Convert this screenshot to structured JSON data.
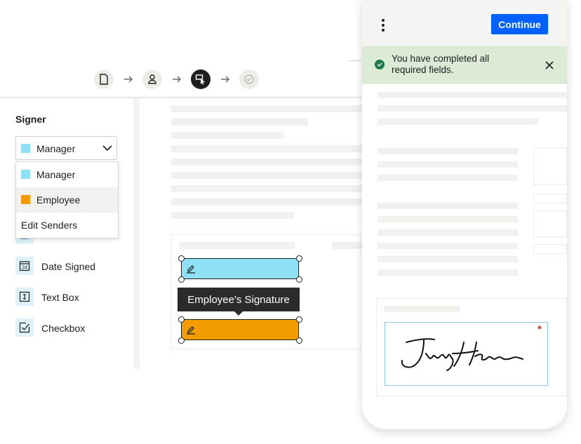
{
  "stepper": {
    "steps": [
      {
        "icon": "document-icon",
        "state": "done"
      },
      {
        "icon": "person-icon",
        "state": "done"
      },
      {
        "icon": "field-cursor-icon",
        "state": "active"
      },
      {
        "icon": "check-circle-icon",
        "state": "pending"
      }
    ]
  },
  "signer": {
    "title": "Signer",
    "selected": {
      "label": "Manager",
      "color": "#8ee0f4"
    },
    "options": [
      {
        "label": "Manager",
        "color": "#8ee0f4"
      },
      {
        "label": "Employee",
        "color": "#f29c00"
      },
      {
        "label": "Edit Senders"
      }
    ]
  },
  "tools": [
    {
      "label": "Date Signed",
      "icon": "calendar-24-icon"
    },
    {
      "label": "Text Box",
      "icon": "text-box-icon"
    },
    {
      "label": "Checkbox",
      "icon": "checkbox-icon"
    }
  ],
  "fields": {
    "manager_color": "#8ee0f4",
    "employee_color": "#f29c00",
    "tooltip": "Employee's Signature"
  },
  "phone": {
    "continue_label": "Continue",
    "banner": "You have completed all required fields.",
    "accent": "#0061fe",
    "required_mark": "*"
  }
}
